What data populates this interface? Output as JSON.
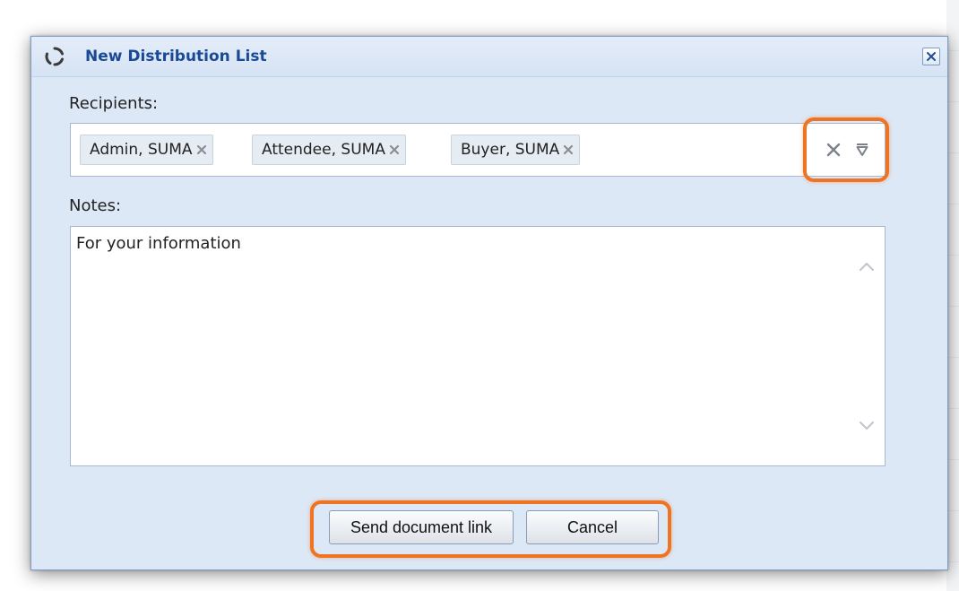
{
  "dialog": {
    "title": "New Distribution List",
    "icons": {
      "title": "loading-circle-icon",
      "close": "close-icon"
    }
  },
  "recipients": {
    "label": "Recipients:",
    "chips": [
      {
        "label": "Admin, SUMA"
      },
      {
        "label": "Attendee, SUMA"
      },
      {
        "label": "Buyer, SUMA"
      }
    ],
    "icons": {
      "chip_remove": "remove-x-icon",
      "clear": "clear-x-icon",
      "dropdown": "dropdown-triangle-icon"
    }
  },
  "notes": {
    "label": "Notes:",
    "value": "For your information"
  },
  "buttons": {
    "send": "Send document link",
    "cancel": "Cancel"
  },
  "colors": {
    "title_text": "#1b4a94",
    "dialog_bg": "#dde8f6",
    "highlight": "#ee7322",
    "chip_bg": "#e6ecf3"
  }
}
